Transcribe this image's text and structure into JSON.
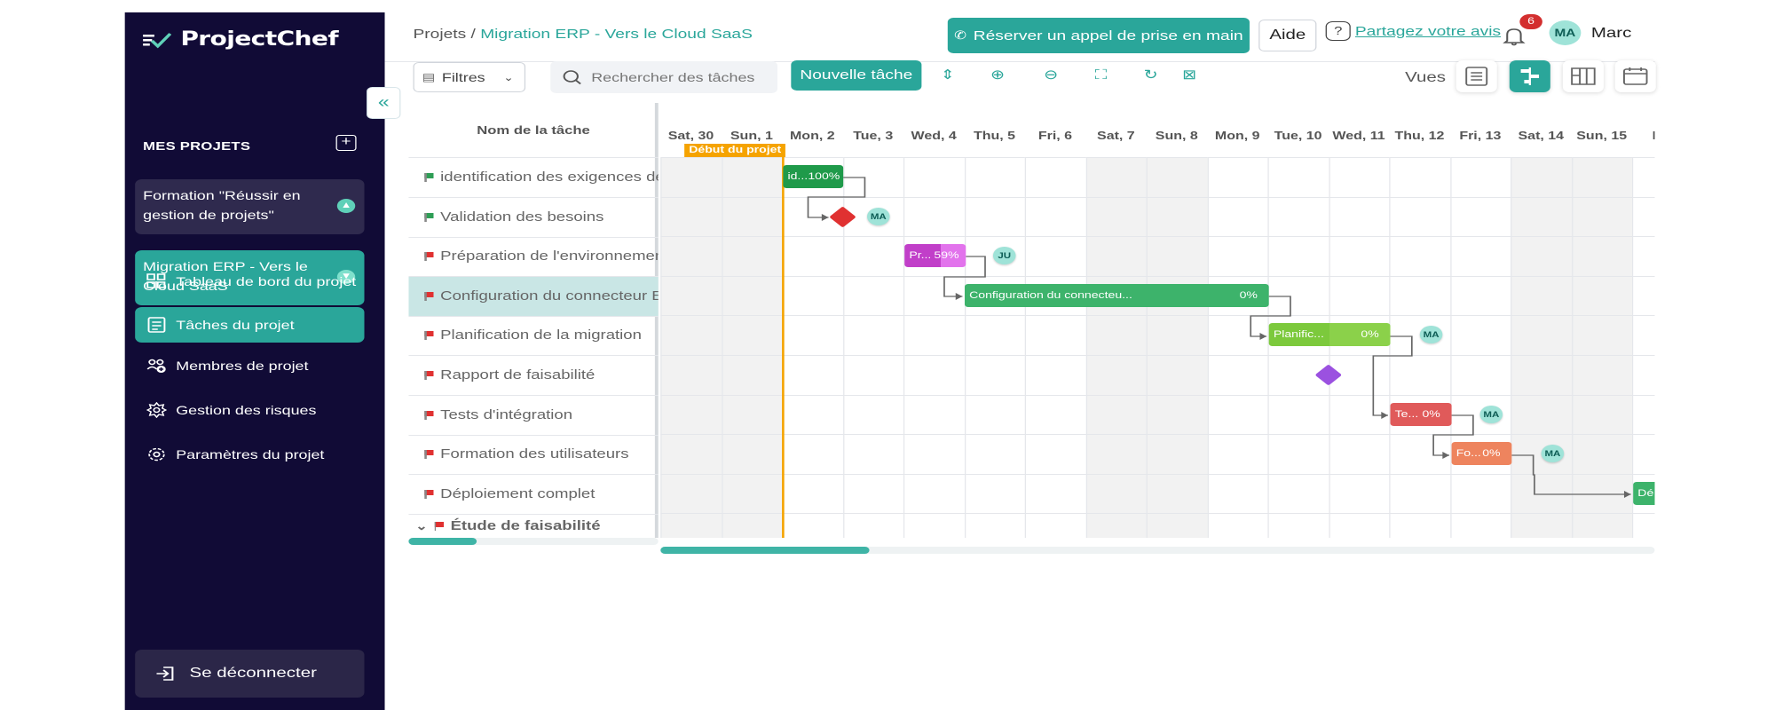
{
  "sidebar": {
    "brand": "ProjectChef",
    "section_title": "MES PROJETS",
    "projects": [
      {
        "label": "Formation \"Réussir en gestion de projets\""
      },
      {
        "label": "Migration ERP - Vers le Cloud SaaS"
      }
    ],
    "nav": [
      {
        "label": "Tableau de bord du projet",
        "icon": "dashboard-icon"
      },
      {
        "label": "Tâches du projet",
        "icon": "tasks-icon"
      },
      {
        "label": "Membres de projet",
        "icon": "members-icon"
      },
      {
        "label": "Gestion des risques",
        "icon": "risk-icon"
      },
      {
        "label": "Paramètres du projet",
        "icon": "settings-icon"
      }
    ],
    "logout_label": "Se déconnecter"
  },
  "header": {
    "breadcrumb_root": "Projets",
    "breadcrumb_sep": "/",
    "breadcrumb_current": "Migration ERP - Vers le Cloud SaaS",
    "book_call_label": "Réserver un appel de prise en main",
    "help_label": "Aide",
    "feedback_label": "Partagez votre avis",
    "notification_count": "6",
    "user_initials": "MA",
    "user_name": "Marc"
  },
  "toolbar": {
    "filters_label": "Filtres",
    "search_placeholder": "Rechercher des tâches",
    "new_task_label": "Nouvelle tâche",
    "views_label": "Vues"
  },
  "gantt": {
    "name_column_header": "Nom de la tâche",
    "project_start_label": "Début du projet",
    "days": [
      "Sat, 30",
      "Sun, 1",
      "Mon, 2",
      "Tue, 3",
      "Wed, 4",
      "Thu, 5",
      "Fri, 6",
      "Sat, 7",
      "Sun, 8",
      "Mon, 9",
      "Tue, 10",
      "Wed, 11",
      "Thu, 12",
      "Fri, 13",
      "Sat, 14",
      "Sun, 15",
      "Mo"
    ],
    "tasks": [
      {
        "name": "identification des exigences de",
        "flag": "green"
      },
      {
        "name": "Validation des besoins",
        "flag": "green"
      },
      {
        "name": "Préparation de l'environnemen",
        "flag": "red"
      },
      {
        "name": "Configuration du connecteur E",
        "flag": "red"
      },
      {
        "name": "Planification de la migration",
        "flag": "red"
      },
      {
        "name": "Rapport de faisabilité",
        "flag": "red"
      },
      {
        "name": "Tests d'intégration",
        "flag": "red"
      },
      {
        "name": "Formation des utilisateurs",
        "flag": "red"
      },
      {
        "name": "Déploiement complet",
        "flag": "red"
      }
    ],
    "group_label": "Étude de faisabilité",
    "bars": [
      {
        "label": "id...",
        "pct": "100%",
        "color": "#1f9a4a"
      },
      {
        "label": "Pr...",
        "pct": "59%",
        "color": "#c13fc9"
      },
      {
        "label": "Configuration du connecteu...",
        "pct": "0%",
        "color": "#3db36b"
      },
      {
        "label": "Planific...",
        "pct": "0%",
        "color": "#7cc93c"
      },
      {
        "label": "Te...",
        "pct": "0%",
        "color": "#e05a5a"
      },
      {
        "label": "Fo...",
        "pct": "0%",
        "color": "#ee845e"
      },
      {
        "label": "Dé",
        "pct": "",
        "color": "#3db36b"
      }
    ],
    "assignees": [
      "MA",
      "JU",
      "MA",
      "MA",
      "MA"
    ],
    "milestone_colors": [
      "#e03131",
      "#9b51e0"
    ]
  },
  "colors": {
    "accent": "#2aa69a",
    "sidebar_bg": "#110b36",
    "project_start": "#f5a300"
  }
}
